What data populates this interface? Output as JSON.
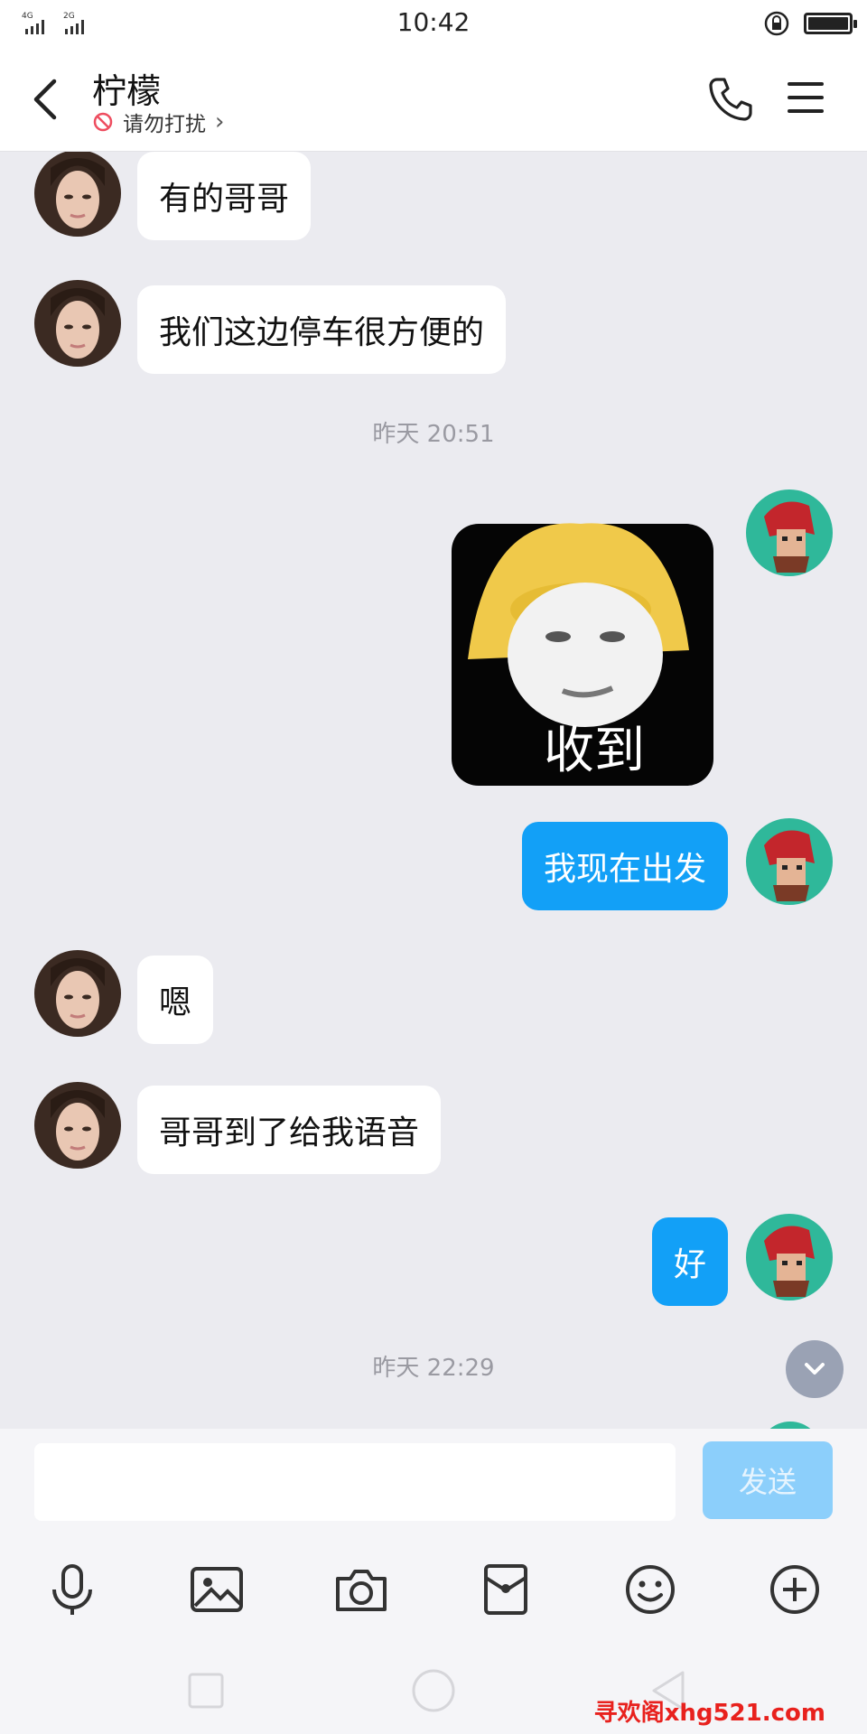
{
  "status_bar": {
    "time": "10:42",
    "network_1": "4G",
    "network_2": "2G"
  },
  "header": {
    "title": "柠檬",
    "subtitle": "请勿打扰",
    "subtitle_chevron": "›"
  },
  "messages": [
    {
      "side": "left",
      "text": "有的哥哥"
    },
    {
      "side": "left",
      "text": "我们这边停车很方便的"
    },
    {
      "type": "timestamp",
      "text": "昨天 20:51"
    },
    {
      "side": "right",
      "type": "sticker",
      "caption": "收到"
    },
    {
      "side": "right",
      "text": "我现在出发"
    },
    {
      "side": "left",
      "text": "嗯"
    },
    {
      "side": "left",
      "text": "哥哥到了给我语音"
    },
    {
      "side": "right",
      "text": "好"
    },
    {
      "type": "timestamp",
      "text": "昨天 22:29"
    }
  ],
  "input": {
    "value": "",
    "placeholder": ""
  },
  "send_label": "发送",
  "toolbar_icons": [
    "microphone-icon",
    "image-icon",
    "camera-icon",
    "red-packet-icon",
    "emoji-icon",
    "plus-icon"
  ],
  "watermark": "寻欢阁xhg521.com",
  "colors": {
    "accent": "#12a0f7",
    "send_disabled": "#8ccffb",
    "background": "#ebebf0"
  }
}
